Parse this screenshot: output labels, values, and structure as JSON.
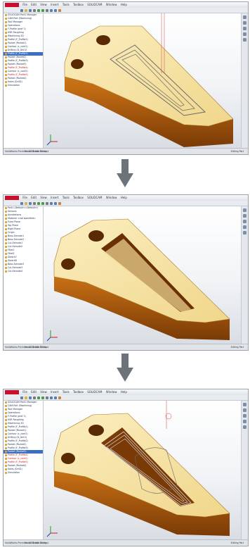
{
  "panels": [
    {
      "menus": [
        "File",
        "Edit",
        "View",
        "Insert",
        "Tools",
        "Toolbox",
        "SOLIDCAM",
        "Window",
        "Help"
      ],
      "tree": [
        {
          "label": "SOLIDCAM Part1 Manager",
          "state": "normal"
        },
        {
          "label": "CAM-Part (Machining)",
          "state": "normal"
        },
        {
          "label": "Tool Manager",
          "state": "normal"
        },
        {
          "label": "Operations",
          "state": "normal"
        },
        {
          "label": "F-Profile (prof 1)",
          "state": "normal"
        },
        {
          "label": "HSR Roughing",
          "state": "normal"
        },
        {
          "label": "iMachining 2D",
          "state": "normal"
        },
        {
          "label": "Profile (F_Profile1)",
          "state": "normal"
        },
        {
          "label": "Pocket (Pocket1)",
          "state": "normal"
        },
        {
          "label": "Contour (c_cont1)",
          "state": "normal"
        },
        {
          "label": "Drilling (D_Drill1)",
          "state": "normal"
        },
        {
          "label": "Profile (F_Profile2)",
          "state": "selected"
        },
        {
          "label": "Pocket (Pocket2)",
          "state": "normal"
        },
        {
          "label": "Profile (F_Profile3)",
          "state": "normal"
        },
        {
          "label": "Pocket (Pocket3)",
          "state": "normal"
        },
        {
          "label": "Profile (F_Profile4)",
          "state": "error"
        },
        {
          "label": "Contour (c_cont2)",
          "state": "normal"
        },
        {
          "label": "Profile (F_Profile5)",
          "state": "error"
        },
        {
          "label": "Pocket (Pocket4)",
          "state": "normal"
        },
        {
          "label": "Holes (Drill2)",
          "state": "normal"
        },
        {
          "label": "Simulation",
          "state": "normal"
        }
      ],
      "status": "SolidWorks Premium 2012 x64 Edition",
      "tabs": "Model  Motion Study 1",
      "units": "Editing Part"
    },
    {
      "menus": [
        "File",
        "Edit",
        "View",
        "Insert",
        "Tools",
        "Toolbox",
        "SOLIDCAM",
        "Window",
        "Help"
      ],
      "tree": [
        {
          "label": "Part1 (Default<<Default>)",
          "state": "normal"
        },
        {
          "label": "Sensors",
          "state": "normal"
        },
        {
          "label": "Annotations",
          "state": "normal"
        },
        {
          "label": "Material <not specified>",
          "state": "normal"
        },
        {
          "label": "Front Plane",
          "state": "normal"
        },
        {
          "label": "Top Plane",
          "state": "normal"
        },
        {
          "label": "Right Plane",
          "state": "normal"
        },
        {
          "label": "Origin",
          "state": "normal"
        },
        {
          "label": "Boss-Extrude1",
          "state": "normal"
        },
        {
          "label": "Boss-Extrude2",
          "state": "normal"
        },
        {
          "label": "Cut-Extrude1",
          "state": "normal"
        },
        {
          "label": "Cut-Extrude2",
          "state": "normal"
        },
        {
          "label": "Fillet1",
          "state": "normal"
        },
        {
          "label": "Fillet2",
          "state": "normal"
        },
        {
          "label": "Sketch7",
          "state": "normal"
        },
        {
          "label": "Sketch8",
          "state": "normal"
        },
        {
          "label": "Boss-Extrude3",
          "state": "normal"
        },
        {
          "label": "Cut-Extrude3",
          "state": "normal"
        },
        {
          "label": "Cut-Extrude4",
          "state": "normal"
        }
      ],
      "status": "SolidWorks Premium 2012 x64 Edition",
      "tabs": "Model  Motion Study 1",
      "units": "Editing Part"
    },
    {
      "menus": [
        "File",
        "Edit",
        "View",
        "Insert",
        "Tools",
        "Toolbox",
        "SOLIDCAM",
        "Window",
        "Help"
      ],
      "tree": [
        {
          "label": "SOLIDCAM Part1 Manager",
          "state": "normal"
        },
        {
          "label": "CAM-Part (Machining)",
          "state": "normal"
        },
        {
          "label": "Tool Manager",
          "state": "normal"
        },
        {
          "label": "Operations",
          "state": "normal"
        },
        {
          "label": "F-Profile (prof 1)",
          "state": "normal"
        },
        {
          "label": "HSR Roughing",
          "state": "normal"
        },
        {
          "label": "iMachining 2D",
          "state": "normal"
        },
        {
          "label": "Profile (F_Profile1)",
          "state": "normal"
        },
        {
          "label": "Pocket (Pocket1)",
          "state": "normal"
        },
        {
          "label": "Contour (c_cont1)",
          "state": "normal"
        },
        {
          "label": "Drilling (D_Drill1)",
          "state": "normal"
        },
        {
          "label": "Profile (F_Profile2)",
          "state": "normal"
        },
        {
          "label": "Pocket (Pocket2)",
          "state": "normal"
        },
        {
          "label": "Profile (F_Profile3)",
          "state": "normal"
        },
        {
          "label": "Pocket (Pocket3)",
          "state": "selected"
        },
        {
          "label": "Profile (F_Profile4)",
          "state": "error"
        },
        {
          "label": "Contour (c_cont2)",
          "state": "error"
        },
        {
          "label": "Profile (F_Profile5)",
          "state": "error"
        },
        {
          "label": "Pocket (Pocket4)",
          "state": "normal"
        },
        {
          "label": "Holes (Drill2)",
          "state": "normal"
        },
        {
          "label": "Simulation",
          "state": "normal"
        }
      ],
      "status": "SolidWorks Premium 2012 x64 Edition",
      "tabs": "Model  Motion Study 1",
      "units": "Editing Part"
    }
  ],
  "colors": {
    "part_top": "#f6e3a2",
    "part_side": "#c46e14",
    "part_shade": "#8a4508",
    "arrow": "#6d737b",
    "toolpath": "#6b6b6b"
  },
  "icons": {
    "arrow": "down-arrow-icon",
    "triad": "axis-triad-icon"
  }
}
